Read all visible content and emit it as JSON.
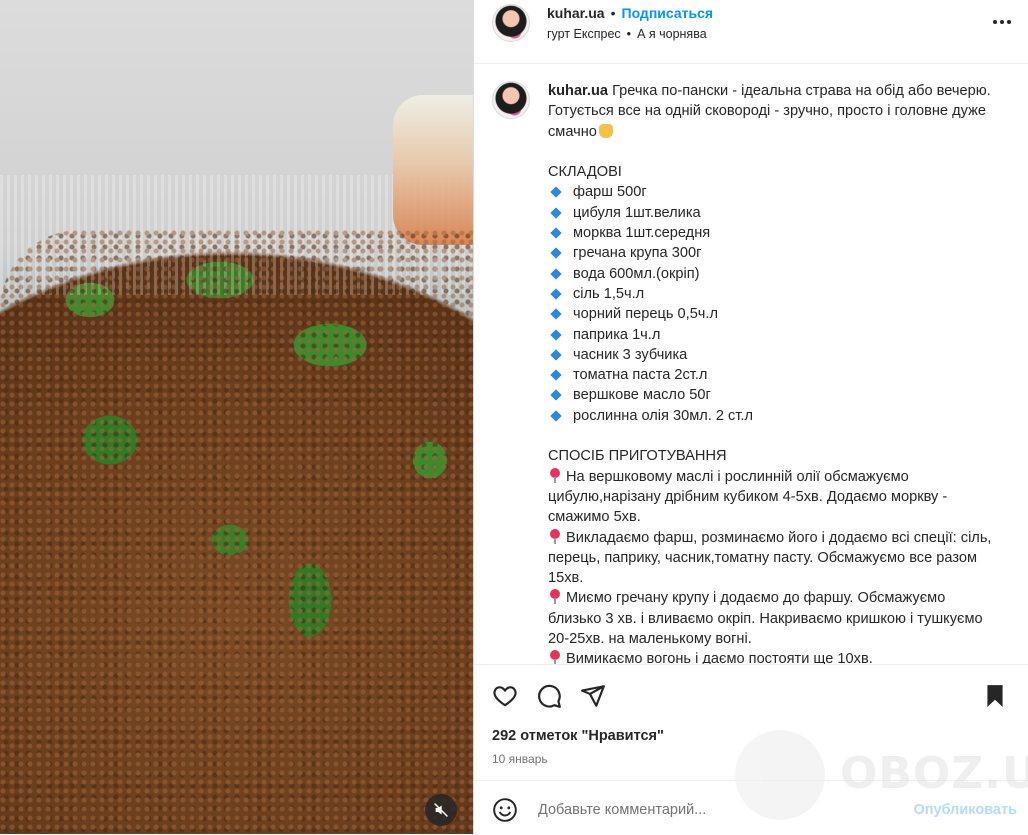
{
  "header": {
    "username": "kuhar.ua",
    "separator": "•",
    "follow_label": "Подписаться",
    "audio": "гурт Експрес",
    "audio_separator": "•",
    "track": "А я чорнява",
    "more_icon": "more-horizontal-icon"
  },
  "caption": {
    "username": "kuhar.ua",
    "intro": "Гречка по-пански - ідеальна страва на обід або вечерю. Готується все на одній сковороді - зручно, просто і головне дуже смачно",
    "ingredients_title": "СКЛАДОВІ",
    "ingredients": [
      "фарш 500г",
      "цибуля 1шт.велика",
      "морква 1шт.середня",
      "гречана крупа 300г",
      "вода 600мл.(окріп)",
      "сіль 1,5ч.л",
      "чорний перець 0,5ч.л",
      "паприка 1ч.л",
      "часник 3 зубчика",
      "томатна паста 2ст.л",
      "вершкове масло 50г",
      "рослинна олія 30мл. 2 ст.л"
    ],
    "method_title": "СПОСІБ ПРИГОТУВАННЯ",
    "steps": [
      "На вершковому маслі і рослинній олії обсмажуємо цибулю,нарізану дрібним кубиком 4-5хв. Додаємо моркву - смажимо 5хв.",
      "Викладаємо фарш, розминаємо його і додаємо всі спеції: сіль, перець, паприку, часник,томатну пасту. Обсмажуємо все разом 15хв.",
      "Миємо гречану крупу і додаємо до фаршу. Обсмажуємо близько 3 хв. і вливаємо окріп. Накриваємо кришкою і тушкуємо 20-25хв. на маленькому вогні.",
      "Вимикаємо вогонь і даємо постояти ще 10хв."
    ]
  },
  "actions": {
    "likes": "292 отметок \"Нравится\"",
    "date": "10 январь"
  },
  "comment": {
    "placeholder": "Добавьте комментарий...",
    "publish_label": "Опубликовать"
  },
  "watermark": {
    "text": "OBOZ.UA"
  },
  "colors": {
    "accent": "#0095f6",
    "publish_disabled": "#b3dbff",
    "bullet": "#2b88e0",
    "pin": "#e8315c"
  }
}
